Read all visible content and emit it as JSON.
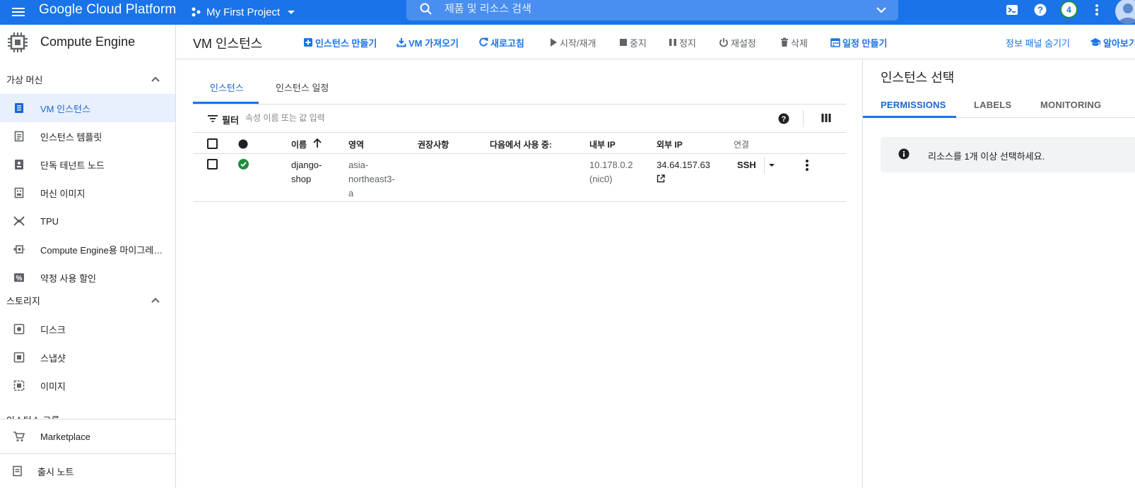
{
  "topbar": {
    "brand": "Google Cloud Platform",
    "project": "My First Project",
    "search_placeholder": "제품 및 리소스 검색",
    "notification_count": "4"
  },
  "sidebar": {
    "title": "Compute Engine",
    "sections": [
      {
        "label": "가상 머신",
        "items": [
          {
            "label": "VM 인스턴스",
            "icon": "vm-instance-icon",
            "active": true
          },
          {
            "label": "인스턴스 템플릿",
            "icon": "template-icon"
          },
          {
            "label": "단독 테넌트 노드",
            "icon": "sole-tenant-icon"
          },
          {
            "label": "머신 이미지",
            "icon": "machine-image-icon"
          },
          {
            "label": "TPU",
            "icon": "tpu-icon"
          },
          {
            "label": "Compute Engine용 마이그레이...",
            "icon": "migrate-icon"
          },
          {
            "label": "약정 사용 할인",
            "icon": "discount-icon"
          }
        ]
      },
      {
        "label": "스토리지",
        "items": [
          {
            "label": "디스크",
            "icon": "disk-icon"
          },
          {
            "label": "스냅샷",
            "icon": "snapshot-icon"
          },
          {
            "label": "이미지",
            "icon": "image-icon"
          }
        ]
      }
    ],
    "partial_section": "인스턴스 그룹",
    "footer_items": [
      {
        "label": "Marketplace",
        "icon": "marketplace-icon"
      },
      {
        "label": "출시 노트",
        "icon": "release-notes-icon"
      }
    ]
  },
  "actionbar": {
    "title": "VM 인스턴스",
    "actions": [
      {
        "label": "인스턴스 만들기",
        "icon": "add-box-icon",
        "style": "primary"
      },
      {
        "label": "VM 가져오기",
        "icon": "import-icon",
        "style": "primary"
      },
      {
        "label": "새로고침",
        "icon": "refresh-icon",
        "style": "primary"
      },
      {
        "label": "시작/재개",
        "icon": "play-icon",
        "style": "disabled"
      },
      {
        "label": "중지",
        "icon": "stop-icon",
        "style": "disabled"
      },
      {
        "label": "정지",
        "icon": "pause-icon",
        "style": "disabled"
      },
      {
        "label": "재설정",
        "icon": "power-icon",
        "style": "disabled"
      },
      {
        "label": "삭제",
        "icon": "trash-icon",
        "style": "disabled"
      },
      {
        "label": "일정 만들기",
        "icon": "calendar-icon",
        "style": "primary"
      }
    ],
    "hide_panel": "정보 패널 숨기기",
    "learn": "알아보기"
  },
  "main": {
    "tabs": [
      {
        "label": "인스턴스",
        "active": true
      },
      {
        "label": "인스턴스 일정",
        "active": false
      }
    ],
    "filter": {
      "label": "필터",
      "placeholder": "속성 이름 또는 값 입력"
    },
    "table": {
      "columns": [
        "이름",
        "영역",
        "권장사항",
        "다음에서 사용 중:",
        "내부 IP",
        "외부 IP",
        "연결"
      ],
      "rows": [
        {
          "name_line1": "django-",
          "name_line2": "shop",
          "zone_line1": "asia-",
          "zone_line2": "northeast3-",
          "zone_line3": "a",
          "recommendation": "",
          "in_use_by": "",
          "internal_ip": "10.178.0.2",
          "internal_nic": "(nic0)",
          "external_ip": "34.64.157.63",
          "connect": "SSH",
          "status": "running"
        }
      ]
    }
  },
  "infopanel": {
    "title": "인스턴스 선택",
    "tabs": [
      {
        "label": "PERMISSIONS",
        "active": true
      },
      {
        "label": "LABELS",
        "active": false
      },
      {
        "label": "MONITORING",
        "active": false
      }
    ],
    "notice": "리소스를 1개 이상 선택하세요."
  },
  "colors": {
    "brand_blue": "#1a73e8",
    "status_green": "#1e8e3e",
    "active_nav_bg": "#e8f0fe"
  }
}
